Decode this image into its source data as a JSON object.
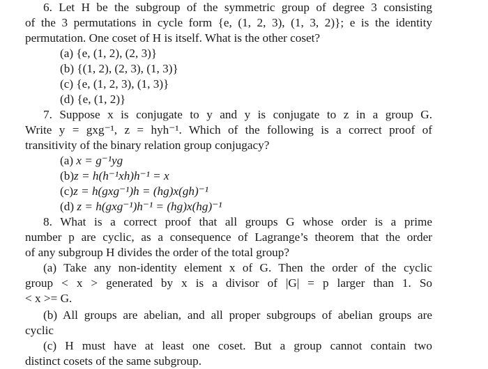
{
  "document": {
    "questions": [
      {
        "number": "6.",
        "stem_lines": [
          "Let H be the subgroup of the symmetric group of degree 3 consisting",
          "of the 3 permutations in cycle form {e, (1, 2, 3), (1, 3, 2)}; e is the identity",
          "permutation. One coset of H is itself. What is the other coset?"
        ],
        "options": [
          {
            "label": "(a)",
            "text": "{e, (1, 2), (2, 3)}"
          },
          {
            "label": "(b)",
            "text": "{(1, 2), (2, 3), (1, 3)}"
          },
          {
            "label": "(c)",
            "text": "{e, (1, 2, 3), (1, 3)}"
          },
          {
            "label": "(d)",
            "text": "{e, (1, 2)}"
          }
        ]
      },
      {
        "number": "7.",
        "stem_lines": [
          "Suppose x is conjugate to y and y is conjugate to z in a group G.",
          "Write y = gxg⁻¹, z = hyh⁻¹. Which of the following is a correct proof of",
          "transitivity of the binary relation group conjugacy?"
        ],
        "options": [
          {
            "label": "(a)",
            "text": "x = g⁻¹yg"
          },
          {
            "label": "(b)",
            "text": "z = h(h⁻¹xh)h⁻¹ = x"
          },
          {
            "label": "(c)",
            "text": "z = h(gxg⁻¹)h = (hg)x(gh)⁻¹"
          },
          {
            "label": "(d)",
            "text": "z = h(gxg⁻¹)h⁻¹ = (hg)x(hg)⁻¹"
          }
        ]
      },
      {
        "number": "8.",
        "stem_lines": [
          "What is a correct proof that all groups G whose order is a prime",
          "number p are cyclic, as a consequence of Lagrange’s theorem that the order",
          "of any subgroup H divides the order of the total group?"
        ],
        "options": [
          {
            "label": "(a)",
            "lines": [
              "Take any non-identity element x of G. Then the order of the cyclic",
              "group < x > generated by x is a divisor of |G| = p larger than 1. So",
              "< x >= G."
            ]
          },
          {
            "label": "(b)",
            "lines": [
              "All groups are abelian, and all proper subgroups of abelian groups are",
              "cyclic"
            ]
          },
          {
            "label": "(c)",
            "lines": [
              "H must have at least one coset. But a group cannot contain two",
              "distinct cosets of the same subgroup."
            ]
          }
        ]
      }
    ]
  }
}
